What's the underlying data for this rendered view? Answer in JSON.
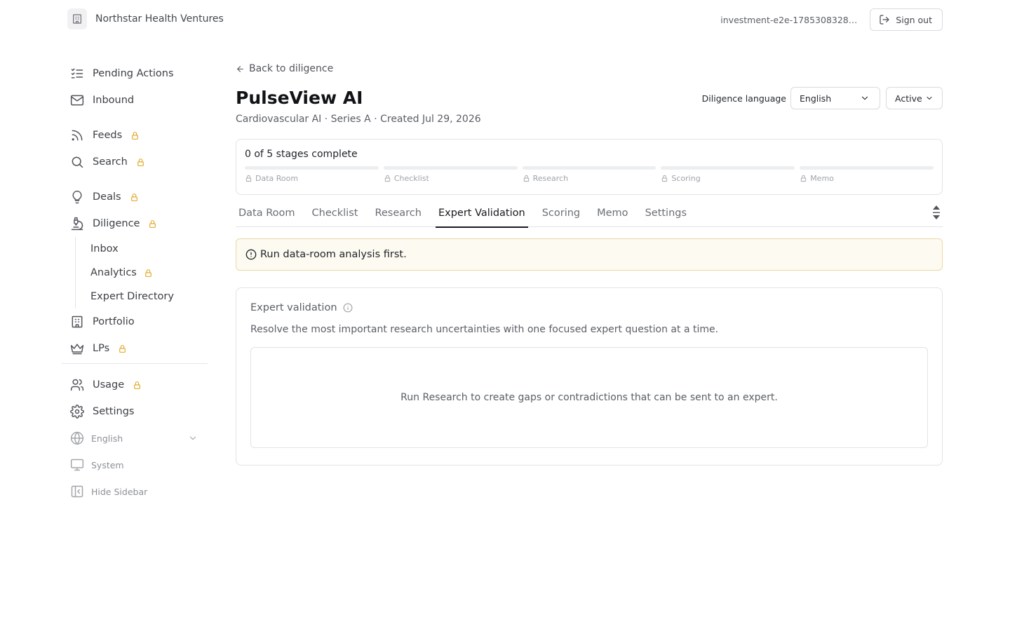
{
  "header": {
    "org_name": "Northstar Health Ventures",
    "org_icon": "building-icon",
    "account": "investment-e2e-1785308328744@example.com",
    "sign_out": "Sign out"
  },
  "sidebar": {
    "items": [
      {
        "label": "Pending Actions",
        "icon": "list-checks-icon",
        "locked": false
      },
      {
        "label": "Inbound",
        "icon": "mail-icon",
        "locked": false
      },
      {
        "label": "Feeds",
        "icon": "rss-icon",
        "locked": true
      },
      {
        "label": "Search",
        "icon": "search-icon",
        "locked": true
      },
      {
        "label": "Deals",
        "icon": "lightbulb-icon",
        "locked": true
      },
      {
        "label": "Diligence",
        "icon": "microscope-icon",
        "locked": true
      },
      {
        "label": "Portfolio",
        "icon": "building-icon",
        "locked": false
      },
      {
        "label": "LPs",
        "icon": "crown-icon",
        "locked": true
      },
      {
        "label": "Usage",
        "icon": "users-icon",
        "locked": true
      },
      {
        "label": "Settings",
        "icon": "gear-icon",
        "locked": false
      }
    ],
    "diligence_sub": [
      {
        "label": "Inbox",
        "locked": false
      },
      {
        "label": "Analytics",
        "locked": true
      },
      {
        "label": "Expert Directory",
        "locked": false
      }
    ],
    "language": "English",
    "theme": "System",
    "hide_sidebar": "Hide Sidebar"
  },
  "main": {
    "back": "Back to diligence",
    "title": "PulseView AI",
    "subtitle": "Cardiovascular AI · Series A · Created Jul 29, 2026",
    "language_label": "Diligence language",
    "language_value": "English",
    "status_value": "Active",
    "progress": {
      "summary": "0 of 5 stages complete",
      "completed": 0,
      "total": 5,
      "stages": [
        "Data Room",
        "Checklist",
        "Research",
        "Scoring",
        "Memo"
      ]
    },
    "tabs": [
      "Data Room",
      "Checklist",
      "Research",
      "Expert Validation",
      "Scoring",
      "Memo",
      "Settings"
    ],
    "active_tab": "Expert Validation",
    "warning": "Run data-room analysis first.",
    "panel": {
      "title": "Expert validation",
      "description": "Resolve the most important research uncertainties with one focused expert question at a time.",
      "empty": "Run Research to create gaps or contradictions that can be sent to an expert."
    }
  },
  "colors": {
    "lock": "#e0a31a",
    "warning_bg": "#fdfaf1",
    "warning_border": "#ecd7a6",
    "active_tab": "#17191d"
  }
}
